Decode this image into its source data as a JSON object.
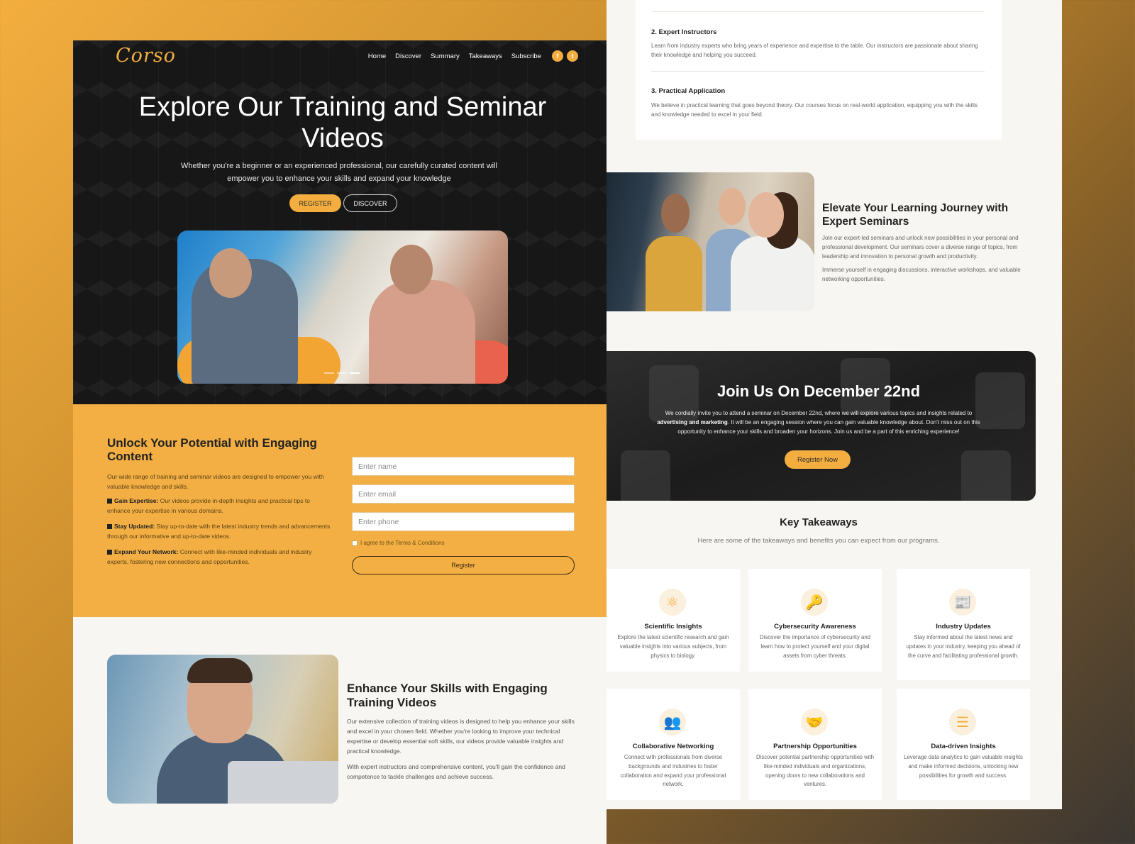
{
  "brand": {
    "logo": "Corso",
    "accent": "#f3ae3f"
  },
  "nav": {
    "items": [
      "Home",
      "Discover",
      "Summary",
      "Takeaways",
      "Subscribe"
    ],
    "social_icons": [
      "facebook-icon",
      "twitter-icon"
    ]
  },
  "hero": {
    "title": "Explore Our Training and Seminar Videos",
    "subtitle": "Whether you're a beginner or an experienced professional, our carefully curated content will empower you to enhance your skills and expand your knowledge",
    "register_label": "REGISTER",
    "discover_label": "DISCOVER"
  },
  "signup": {
    "heading": "Unlock Your Potential with Engaging Content",
    "intro": "Our wide range of training and seminar videos are designed to empower you with valuable knowledge and skills.",
    "bullets": [
      {
        "title": "Gain Expertise:",
        "text": "Our videos provide in-depth insights and practical tips to enhance your expertise in various domains."
      },
      {
        "title": "Stay Updated:",
        "text": "Stay up-to-date with the latest industry trends and advancements through our informative and up-to-date videos."
      },
      {
        "title": "Expand Your Network:",
        "text": "Connect with like-minded individuals and industry experts, fostering new connections and opportunities."
      }
    ],
    "form": {
      "name_placeholder": "Enter name",
      "email_placeholder": "Enter email",
      "phone_placeholder": "Enter phone",
      "agree_label": "I agree to the Terms & Conditions",
      "submit_label": "Register"
    }
  },
  "skills": {
    "heading": "Enhance Your Skills with Engaging Training Videos",
    "para1": "Our extensive collection of training videos is designed to help you enhance your skills and excel in your chosen field. Whether you're looking to improve your technical expertise or develop essential soft skills, our videos provide valuable insights and practical knowledge.",
    "para2": "With expert instructors and comprehensive content, you'll gain the confidence and competence to tackle challenges and achieve success."
  },
  "features": {
    "item2_title": "2. Expert Instructors",
    "item2_text": "Learn from industry experts who bring years of experience and expertise to the table. Our instructors are passionate about sharing their knowledge and helping you succeed.",
    "item3_title": "3. Practical Application",
    "item3_text": "We believe in practical learning that goes beyond theory. Our courses focus on real-world application, equipping you with the skills and knowledge needed to excel in your field."
  },
  "seminars": {
    "heading": "Elevate Your Learning Journey with Expert Seminars",
    "para1": "Join our expert-led seminars and unlock new possibilities in your personal and professional development. Our seminars cover a diverse range of topics, from leadership and innovation to personal growth and productivity.",
    "para2": "Immerse yourself in engaging discussions, interactive workshops, and valuable networking opportunities."
  },
  "join": {
    "heading": "Join Us On December 22nd",
    "text_before": "We cordially invite you to attend a seminar on December 22nd, where we will explore various topics and insights related to ",
    "text_bold": "advertising and marketing",
    "text_after": ". It will be an engaging session where you can gain valuable knowledge about. Don't miss out on this opportunity to enhance your skills and broaden your horizons. Join us and be a part of this enriching experience!",
    "button_label": "Register Now"
  },
  "takeaways": {
    "heading": "Key Takeaways",
    "subtitle": "Here are some of the takeaways and benefits you can expect from our programs.",
    "items": [
      {
        "icon": "atom-icon",
        "glyph": "⚛",
        "title": "Scientific Insights",
        "desc": "Explore the latest scientific research and gain valuable insights into various subjects, from physics to biology."
      },
      {
        "icon": "key-icon",
        "glyph": "🔑",
        "title": "Cybersecurity Awareness",
        "desc": "Discover the importance of cybersecurity and learn how to protect yourself and your digital assets from cyber threats."
      },
      {
        "icon": "newspaper-icon",
        "glyph": "📰",
        "title": "Industry Updates",
        "desc": "Stay informed about the latest news and updates in your industry, keeping you ahead of the curve and facilitating professional growth."
      },
      {
        "icon": "people-icon",
        "glyph": "👥",
        "title": "Collaborative Networking",
        "desc": "Connect with professionals from diverse backgrounds and industries to foster collaboration and expand your professional network."
      },
      {
        "icon": "handshake-icon",
        "glyph": "🤝",
        "title": "Partnership Opportunities",
        "desc": "Discover potential partnership opportunities with like-minded individuals and organizations, opening doors to new collaborations and ventures."
      },
      {
        "icon": "list-chart-icon",
        "glyph": "☰",
        "title": "Data-driven Insights",
        "desc": "Leverage data analytics to gain valuable insights and make informed decisions, unlocking new possibilities for growth and success."
      }
    ]
  }
}
